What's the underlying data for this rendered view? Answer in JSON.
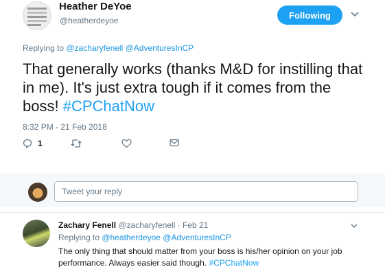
{
  "main_tweet": {
    "author_name": "Heather DeYoe",
    "author_handle": "@heatherdeyoe",
    "follow_label": "Following",
    "replying_prefix": "Replying to ",
    "replying_mentions": "@zacharyfenell @AdventuresInCP",
    "text": "That generally works (thanks M&D for instilling that in me). It's just extra tough if it comes from the boss! ",
    "hashtag": "#CPChatNow",
    "timestamp": "8:32 PM - 21 Feb 2018",
    "reply_count": "1",
    "icons": [
      "reply-icon",
      "retweet-icon",
      "like-icon",
      "message-icon",
      "chevron-down-icon"
    ]
  },
  "reply_box": {
    "placeholder": "Tweet your reply"
  },
  "reply_tweet": {
    "author_name": "Zachary Fenell",
    "author_handle_date": "@zacharyfenell · Feb 21",
    "replying_prefix": "Replying to ",
    "replying_mentions": "@heatherdeyoe @AdventuresInCP",
    "text": "The only thing that should matter from your boss is his/her opinion on your job performance. Always easier said though. ",
    "hashtag": "#CPChatNow"
  },
  "colors": {
    "accent": "#1da1f2",
    "mention": "#1b95e0",
    "muted": "#657786",
    "band": "#f5f8fa"
  }
}
